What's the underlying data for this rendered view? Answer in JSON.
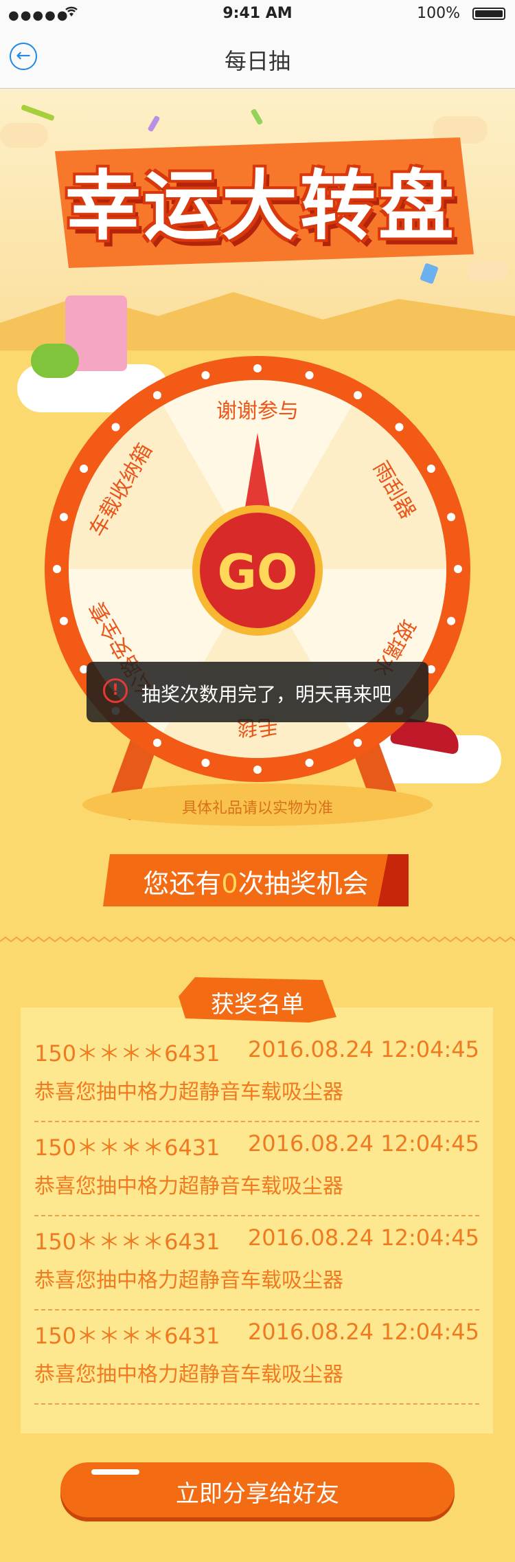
{
  "status": {
    "signal": "●●●●●",
    "time": "9:41 AM",
    "battery": "100%"
  },
  "nav": {
    "title": "每日抽"
  },
  "banner": {
    "title": "幸运大转盘"
  },
  "wheel": {
    "segments": [
      "谢谢参与",
      "雨刮器",
      "玻璃水",
      "毛毯",
      "公路安全套",
      "车载收纳箱"
    ],
    "go_label": "GO"
  },
  "base_note": "具体礼品请以实物为准",
  "chance": {
    "prefix": "您还有",
    "count": "0",
    "suffix": "次抽奖机会"
  },
  "toast": {
    "message": "抽奖次数用完了，明天再来吧",
    "icon": "alert-icon"
  },
  "winners": {
    "title": "获奖名单",
    "rows": [
      {
        "phone": "150＊＊＊＊6431",
        "date": "2016.08.24   12:04:45",
        "prize": "恭喜您抽中格力超静音车载吸尘器"
      },
      {
        "phone": "150＊＊＊＊6431",
        "date": "2016.08.24   12:04:45",
        "prize": "恭喜您抽中格力超静音车载吸尘器"
      },
      {
        "phone": "150＊＊＊＊6431",
        "date": "2016.08.24   12:04:45",
        "prize": "恭喜您抽中格力超静音车载吸尘器"
      },
      {
        "phone": "150＊＊＊＊6431",
        "date": "2016.08.24   12:04:45",
        "prize": "恭喜您抽中格力超静音车载吸尘器"
      }
    ]
  },
  "share": {
    "label": "立即分享给好友"
  },
  "colors": {
    "accent": "#f36c14",
    "wheel_rim": "#f25a16",
    "background": "#fbd96f",
    "text_orange": "#f07a20"
  }
}
